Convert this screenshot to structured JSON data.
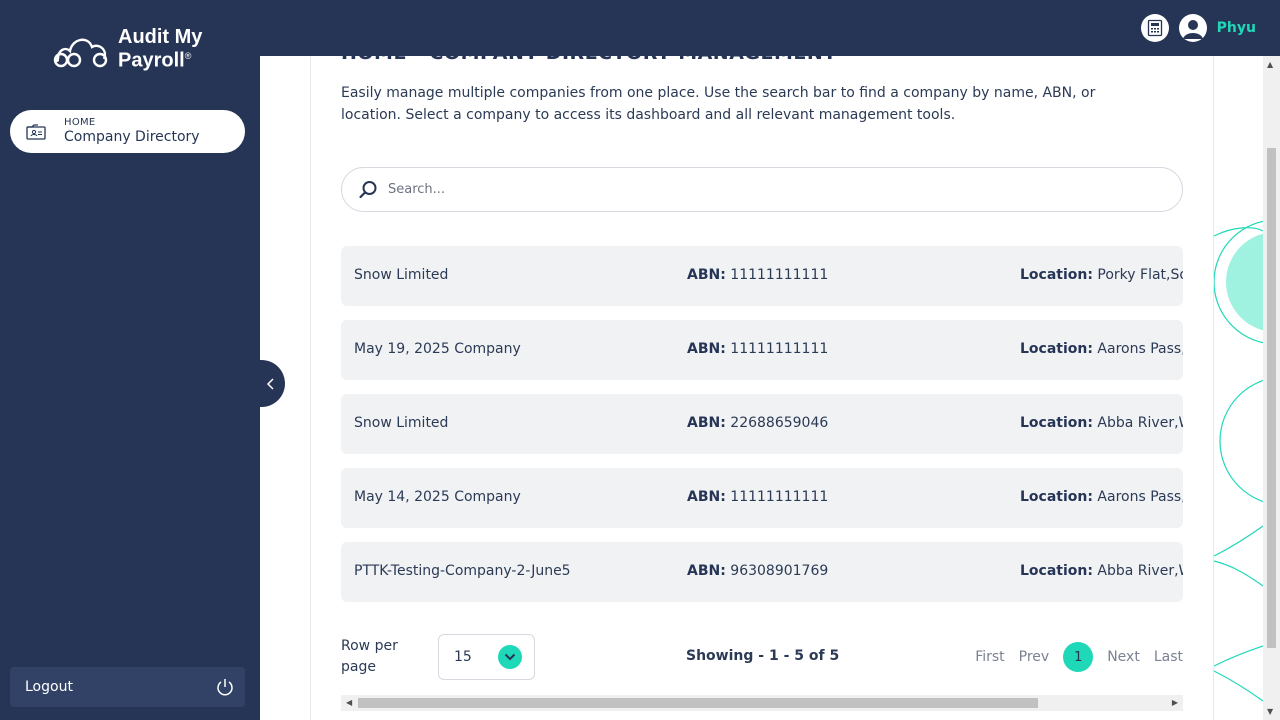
{
  "app": {
    "logo_line1": "Audit My",
    "logo_line2": "Payroll",
    "logo_mark": "®",
    "username": "Phyu",
    "accent_color": "#1fd8b8",
    "nav_bg_color": "#263556"
  },
  "sidebar": {
    "items": [
      {
        "kicker": "HOME",
        "label": "Company Directory",
        "icon": "company-directory-icon"
      }
    ],
    "logout_label": "Logout"
  },
  "page": {
    "heading": "HOME - COMPANY DIRECTORY MANAGEMENT",
    "description": "Easily manage multiple companies from one place. Use the search bar to find a company by name, ABN, or location. Select a company to access its dashboard and all relevant management tools.",
    "search_placeholder": "Search..."
  },
  "companies": [
    {
      "name": "Snow Limited",
      "abn_label": "ABN:",
      "abn": "11111111111",
      "location_label": "Location:",
      "location": "Porky Flat,Sou"
    },
    {
      "name": "May 19, 2025 Company",
      "abn_label": "ABN:",
      "abn": "11111111111",
      "location_label": "Location:",
      "location": "Aarons Pass,N"
    },
    {
      "name": "Snow Limited",
      "abn_label": "ABN:",
      "abn": "22688659046",
      "location_label": "Location:",
      "location": "Abba River,W"
    },
    {
      "name": "May 14, 2025 Company",
      "abn_label": "ABN:",
      "abn": "11111111111",
      "location_label": "Location:",
      "location": "Aarons Pass,N"
    },
    {
      "name": "PTTK-Testing-Company-2-June5",
      "abn_label": "ABN:",
      "abn": "96308901769",
      "location_label": "Location:",
      "location": "Abba River,W"
    }
  ],
  "footer": {
    "rows_per_page_label": "Row per page",
    "rows_per_page_value": "15",
    "showing": "Showing - 1 - 5 of 5",
    "pager": {
      "first": "First",
      "prev": "Prev",
      "current": "1",
      "next": "Next",
      "last": "Last"
    }
  }
}
